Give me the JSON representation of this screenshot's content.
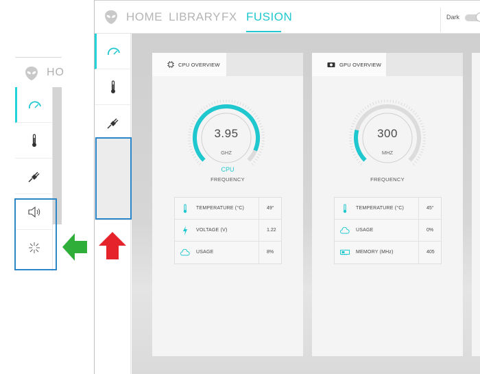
{
  "nav": {
    "home": "HOME",
    "library": "LIBRARY",
    "fx": "FX",
    "fusion": "FUSION",
    "active": "FUSION"
  },
  "theme": {
    "dark_label": "Dark",
    "accent": "#1fc7cf",
    "highlight_box": "#2a86c8",
    "arrow_green": "#2fae3a",
    "arrow_red": "#e4232a"
  },
  "inset": {
    "home_partial": "HO"
  },
  "sidebar": {
    "items": [
      {
        "icon": "speedometer-icon"
      },
      {
        "icon": "thermometer-icon"
      },
      {
        "icon": "power-plug-icon"
      }
    ],
    "inset_extra_items": [
      {
        "icon": "speaker-icon"
      },
      {
        "icon": "light-burst-icon"
      }
    ]
  },
  "cpu": {
    "title": "CPU OVERVIEW",
    "value": "3.95",
    "unit": "GHZ",
    "label1": "CPU",
    "label2": "FREQUENCY",
    "gauge_fraction": 0.92,
    "stats": [
      {
        "name": "TEMPERATURE (°C)",
        "value": "49°",
        "icon": "thermometer-icon"
      },
      {
        "name": "VOLTAGE (V)",
        "value": "1.22",
        "icon": "lightning-icon"
      },
      {
        "name": "USAGE",
        "value": "8%",
        "icon": "cloud-icon"
      }
    ]
  },
  "gpu": {
    "title": "GPU OVERVIEW",
    "value": "300",
    "unit": "MHZ",
    "label2": "FREQUENCY",
    "gauge_fraction": 0.22,
    "stats": [
      {
        "name": "TEMPERATURE (°C)",
        "value": "45°",
        "icon": "thermometer-icon"
      },
      {
        "name": "USAGE",
        "value": "0%",
        "icon": "cloud-icon"
      },
      {
        "name": "MEMORY (MHz)",
        "value": "405",
        "icon": "memory-card-icon"
      }
    ]
  }
}
